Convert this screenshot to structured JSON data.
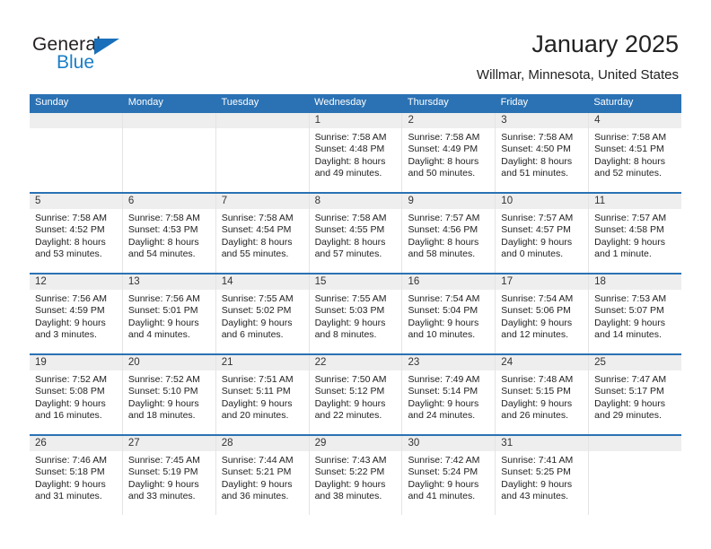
{
  "brand": {
    "name_part1": "General",
    "name_part2": "Blue",
    "accent_color": "#1a7ec8",
    "triangle_color": "#1a6fba"
  },
  "header": {
    "title": "January 2025",
    "subtitle": "Willmar, Minnesota, United States"
  },
  "theme": {
    "header_bar_color": "#2b72b4",
    "day_number_band_color": "#eeeeee",
    "cell_divider_color": "#e4e4e4"
  },
  "weekdays": [
    "Sunday",
    "Monday",
    "Tuesday",
    "Wednesday",
    "Thursday",
    "Friday",
    "Saturday"
  ],
  "weeks": [
    [
      {
        "day": "",
        "sunrise": "",
        "sunset": "",
        "daylight_line1": "",
        "daylight_line2": "",
        "empty": true
      },
      {
        "day": "",
        "sunrise": "",
        "sunset": "",
        "daylight_line1": "",
        "daylight_line2": "",
        "empty": true
      },
      {
        "day": "",
        "sunrise": "",
        "sunset": "",
        "daylight_line1": "",
        "daylight_line2": "",
        "empty": true
      },
      {
        "day": "1",
        "sunrise": "Sunrise: 7:58 AM",
        "sunset": "Sunset: 4:48 PM",
        "daylight_line1": "Daylight: 8 hours",
        "daylight_line2": "and 49 minutes.",
        "empty": false
      },
      {
        "day": "2",
        "sunrise": "Sunrise: 7:58 AM",
        "sunset": "Sunset: 4:49 PM",
        "daylight_line1": "Daylight: 8 hours",
        "daylight_line2": "and 50 minutes.",
        "empty": false
      },
      {
        "day": "3",
        "sunrise": "Sunrise: 7:58 AM",
        "sunset": "Sunset: 4:50 PM",
        "daylight_line1": "Daylight: 8 hours",
        "daylight_line2": "and 51 minutes.",
        "empty": false
      },
      {
        "day": "4",
        "sunrise": "Sunrise: 7:58 AM",
        "sunset": "Sunset: 4:51 PM",
        "daylight_line1": "Daylight: 8 hours",
        "daylight_line2": "and 52 minutes.",
        "empty": false
      }
    ],
    [
      {
        "day": "5",
        "sunrise": "Sunrise: 7:58 AM",
        "sunset": "Sunset: 4:52 PM",
        "daylight_line1": "Daylight: 8 hours",
        "daylight_line2": "and 53 minutes.",
        "empty": false
      },
      {
        "day": "6",
        "sunrise": "Sunrise: 7:58 AM",
        "sunset": "Sunset: 4:53 PM",
        "daylight_line1": "Daylight: 8 hours",
        "daylight_line2": "and 54 minutes.",
        "empty": false
      },
      {
        "day": "7",
        "sunrise": "Sunrise: 7:58 AM",
        "sunset": "Sunset: 4:54 PM",
        "daylight_line1": "Daylight: 8 hours",
        "daylight_line2": "and 55 minutes.",
        "empty": false
      },
      {
        "day": "8",
        "sunrise": "Sunrise: 7:58 AM",
        "sunset": "Sunset: 4:55 PM",
        "daylight_line1": "Daylight: 8 hours",
        "daylight_line2": "and 57 minutes.",
        "empty": false
      },
      {
        "day": "9",
        "sunrise": "Sunrise: 7:57 AM",
        "sunset": "Sunset: 4:56 PM",
        "daylight_line1": "Daylight: 8 hours",
        "daylight_line2": "and 58 minutes.",
        "empty": false
      },
      {
        "day": "10",
        "sunrise": "Sunrise: 7:57 AM",
        "sunset": "Sunset: 4:57 PM",
        "daylight_line1": "Daylight: 9 hours",
        "daylight_line2": "and 0 minutes.",
        "empty": false
      },
      {
        "day": "11",
        "sunrise": "Sunrise: 7:57 AM",
        "sunset": "Sunset: 4:58 PM",
        "daylight_line1": "Daylight: 9 hours",
        "daylight_line2": "and 1 minute.",
        "empty": false
      }
    ],
    [
      {
        "day": "12",
        "sunrise": "Sunrise: 7:56 AM",
        "sunset": "Sunset: 4:59 PM",
        "daylight_line1": "Daylight: 9 hours",
        "daylight_line2": "and 3 minutes.",
        "empty": false
      },
      {
        "day": "13",
        "sunrise": "Sunrise: 7:56 AM",
        "sunset": "Sunset: 5:01 PM",
        "daylight_line1": "Daylight: 9 hours",
        "daylight_line2": "and 4 minutes.",
        "empty": false
      },
      {
        "day": "14",
        "sunrise": "Sunrise: 7:55 AM",
        "sunset": "Sunset: 5:02 PM",
        "daylight_line1": "Daylight: 9 hours",
        "daylight_line2": "and 6 minutes.",
        "empty": false
      },
      {
        "day": "15",
        "sunrise": "Sunrise: 7:55 AM",
        "sunset": "Sunset: 5:03 PM",
        "daylight_line1": "Daylight: 9 hours",
        "daylight_line2": "and 8 minutes.",
        "empty": false
      },
      {
        "day": "16",
        "sunrise": "Sunrise: 7:54 AM",
        "sunset": "Sunset: 5:04 PM",
        "daylight_line1": "Daylight: 9 hours",
        "daylight_line2": "and 10 minutes.",
        "empty": false
      },
      {
        "day": "17",
        "sunrise": "Sunrise: 7:54 AM",
        "sunset": "Sunset: 5:06 PM",
        "daylight_line1": "Daylight: 9 hours",
        "daylight_line2": "and 12 minutes.",
        "empty": false
      },
      {
        "day": "18",
        "sunrise": "Sunrise: 7:53 AM",
        "sunset": "Sunset: 5:07 PM",
        "daylight_line1": "Daylight: 9 hours",
        "daylight_line2": "and 14 minutes.",
        "empty": false
      }
    ],
    [
      {
        "day": "19",
        "sunrise": "Sunrise: 7:52 AM",
        "sunset": "Sunset: 5:08 PM",
        "daylight_line1": "Daylight: 9 hours",
        "daylight_line2": "and 16 minutes.",
        "empty": false
      },
      {
        "day": "20",
        "sunrise": "Sunrise: 7:52 AM",
        "sunset": "Sunset: 5:10 PM",
        "daylight_line1": "Daylight: 9 hours",
        "daylight_line2": "and 18 minutes.",
        "empty": false
      },
      {
        "day": "21",
        "sunrise": "Sunrise: 7:51 AM",
        "sunset": "Sunset: 5:11 PM",
        "daylight_line1": "Daylight: 9 hours",
        "daylight_line2": "and 20 minutes.",
        "empty": false
      },
      {
        "day": "22",
        "sunrise": "Sunrise: 7:50 AM",
        "sunset": "Sunset: 5:12 PM",
        "daylight_line1": "Daylight: 9 hours",
        "daylight_line2": "and 22 minutes.",
        "empty": false
      },
      {
        "day": "23",
        "sunrise": "Sunrise: 7:49 AM",
        "sunset": "Sunset: 5:14 PM",
        "daylight_line1": "Daylight: 9 hours",
        "daylight_line2": "and 24 minutes.",
        "empty": false
      },
      {
        "day": "24",
        "sunrise": "Sunrise: 7:48 AM",
        "sunset": "Sunset: 5:15 PM",
        "daylight_line1": "Daylight: 9 hours",
        "daylight_line2": "and 26 minutes.",
        "empty": false
      },
      {
        "day": "25",
        "sunrise": "Sunrise: 7:47 AM",
        "sunset": "Sunset: 5:17 PM",
        "daylight_line1": "Daylight: 9 hours",
        "daylight_line2": "and 29 minutes.",
        "empty": false
      }
    ],
    [
      {
        "day": "26",
        "sunrise": "Sunrise: 7:46 AM",
        "sunset": "Sunset: 5:18 PM",
        "daylight_line1": "Daylight: 9 hours",
        "daylight_line2": "and 31 minutes.",
        "empty": false
      },
      {
        "day": "27",
        "sunrise": "Sunrise: 7:45 AM",
        "sunset": "Sunset: 5:19 PM",
        "daylight_line1": "Daylight: 9 hours",
        "daylight_line2": "and 33 minutes.",
        "empty": false
      },
      {
        "day": "28",
        "sunrise": "Sunrise: 7:44 AM",
        "sunset": "Sunset: 5:21 PM",
        "daylight_line1": "Daylight: 9 hours",
        "daylight_line2": "and 36 minutes.",
        "empty": false
      },
      {
        "day": "29",
        "sunrise": "Sunrise: 7:43 AM",
        "sunset": "Sunset: 5:22 PM",
        "daylight_line1": "Daylight: 9 hours",
        "daylight_line2": "and 38 minutes.",
        "empty": false
      },
      {
        "day": "30",
        "sunrise": "Sunrise: 7:42 AM",
        "sunset": "Sunset: 5:24 PM",
        "daylight_line1": "Daylight: 9 hours",
        "daylight_line2": "and 41 minutes.",
        "empty": false
      },
      {
        "day": "31",
        "sunrise": "Sunrise: 7:41 AM",
        "sunset": "Sunset: 5:25 PM",
        "daylight_line1": "Daylight: 9 hours",
        "daylight_line2": "and 43 minutes.",
        "empty": false
      },
      {
        "day": "",
        "sunrise": "",
        "sunset": "",
        "daylight_line1": "",
        "daylight_line2": "",
        "empty": true
      }
    ]
  ]
}
